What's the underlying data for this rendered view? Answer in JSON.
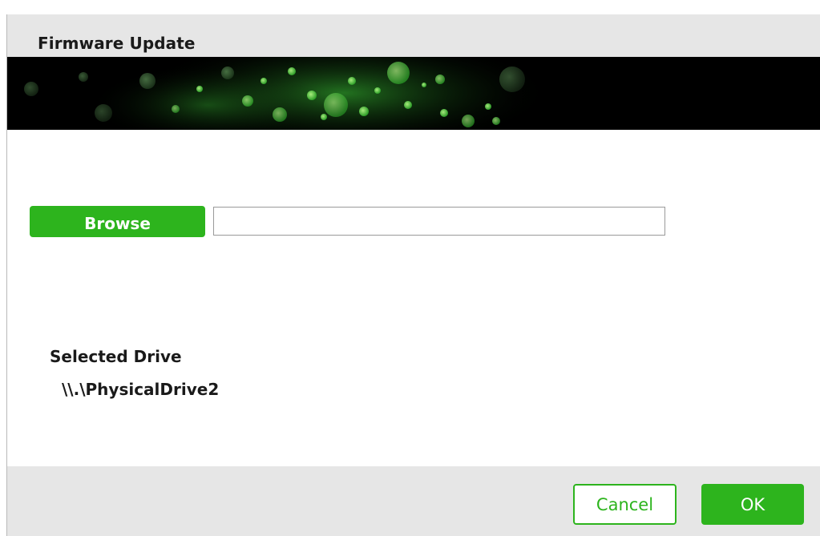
{
  "window": {
    "title": "Firmware Update"
  },
  "banner": {
    "description": "decorative green bokeh banner",
    "accent": "#2db41d"
  },
  "file_picker": {
    "browse_label": "Browse",
    "path_value": "",
    "path_placeholder": ""
  },
  "drive": {
    "label": "Selected Drive",
    "value": "\\\\.\\PhysicalDrive2"
  },
  "footer": {
    "cancel_label": "Cancel",
    "ok_label": "OK"
  },
  "colors": {
    "accent": "#2db41d",
    "titlebar_bg": "#e6e6e6",
    "footer_bg": "#e6e6e6",
    "banner_bg": "#000000"
  }
}
